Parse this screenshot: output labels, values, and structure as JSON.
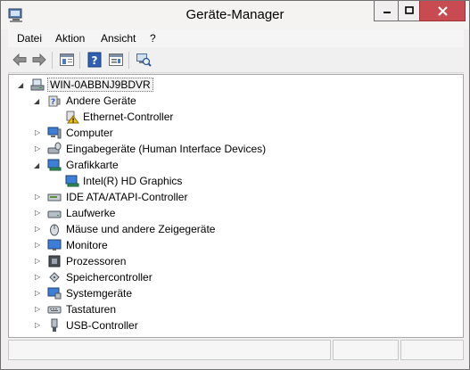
{
  "window": {
    "title": "Geräte-Manager"
  },
  "menu": [
    "Datei",
    "Aktion",
    "Ansicht",
    "?"
  ],
  "toolbar_icons": [
    "back-arrow-icon",
    "forward-arrow-icon",
    "properties-window-icon",
    "help-icon",
    "device-view-icon",
    "scan-hardware-icon"
  ],
  "tree": {
    "root": "WIN-0ABBNJ9BDVR",
    "items": [
      {
        "label": "Andere Geräte",
        "expanded": true,
        "icon": "unknown-device-icon"
      },
      {
        "label": "Ethernet-Controller",
        "child": true,
        "icon": "warning-device-icon"
      },
      {
        "label": "Computer",
        "expanded": false,
        "icon": "computer-icon"
      },
      {
        "label": "Eingabegeräte (Human Interface Devices)",
        "expanded": false,
        "icon": "hid-icon"
      },
      {
        "label": "Grafikkarte",
        "expanded": true,
        "icon": "display-adapter-icon"
      },
      {
        "label": "Intel(R) HD Graphics",
        "child": true,
        "icon": "display-adapter-icon"
      },
      {
        "label": "IDE ATA/ATAPI-Controller",
        "expanded": false,
        "icon": "ide-controller-icon"
      },
      {
        "label": "Laufwerke",
        "expanded": false,
        "icon": "disk-drive-icon"
      },
      {
        "label": "Mäuse und andere Zeigegeräte",
        "expanded": false,
        "icon": "mouse-icon"
      },
      {
        "label": "Monitore",
        "expanded": false,
        "icon": "monitor-icon"
      },
      {
        "label": "Prozessoren",
        "expanded": false,
        "icon": "processor-icon"
      },
      {
        "label": "Speichercontroller",
        "expanded": false,
        "icon": "storage-controller-icon"
      },
      {
        "label": "Systemgeräte",
        "expanded": false,
        "icon": "system-devices-icon"
      },
      {
        "label": "Tastaturen",
        "expanded": false,
        "icon": "keyboard-icon"
      },
      {
        "label": "USB-Controller",
        "expanded": false,
        "icon": "usb-icon"
      }
    ]
  },
  "colors": {
    "close_button": "#c74b50",
    "selection_border": "#7a7a7a",
    "warning": "#f2c200"
  }
}
